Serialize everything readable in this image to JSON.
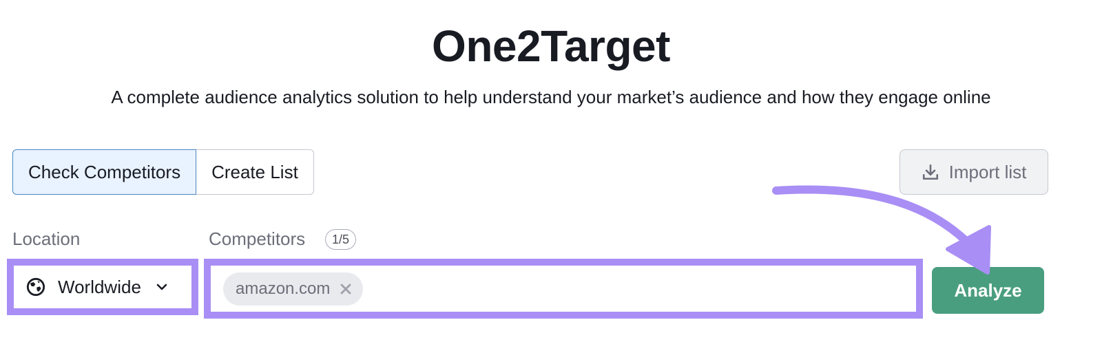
{
  "header": {
    "title": "One2Target",
    "subtitle": "A complete audience analytics solution to help understand your market’s audience and how they engage online"
  },
  "tabs": [
    {
      "label": "Check Competitors",
      "active": true
    },
    {
      "label": "Create List",
      "active": false
    }
  ],
  "import_button": {
    "label": "Import list",
    "icon": "download-icon"
  },
  "location": {
    "label": "Location",
    "value": "Worldwide",
    "icon": "globe-icon"
  },
  "competitors": {
    "label": "Competitors",
    "counter": "1/5",
    "chips": [
      {
        "label": "amazon.com"
      }
    ]
  },
  "analyze_button": {
    "label": "Analyze"
  },
  "colors": {
    "highlight": "#a98ef5",
    "analyze": "#4a9e80",
    "active_tab_bg": "#e9f2ff",
    "active_tab_border": "#4a86c5"
  }
}
